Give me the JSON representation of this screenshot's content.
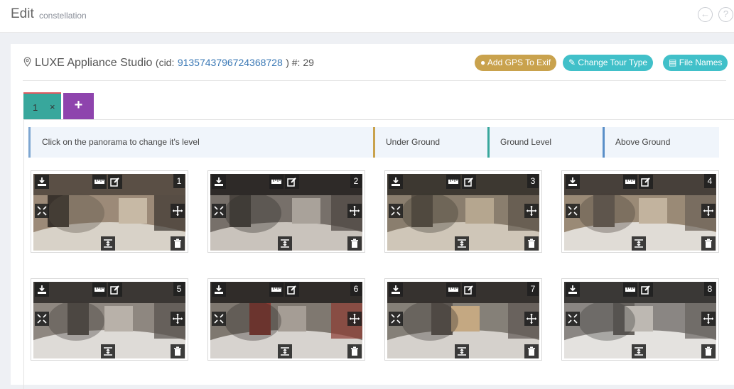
{
  "header": {
    "title": "Edit",
    "subtitle": "constellation",
    "back_icon": "arrow-left-circle-icon",
    "help_icon": "question-circle-icon"
  },
  "location": {
    "name": "LUXE Appliance Studio",
    "cid_prefix": "(cid:",
    "cid": "9135743796724368728",
    "cid_suffix": ") #: 29"
  },
  "actions": {
    "gps_label": "Add GPS To Exif",
    "tour_label": "Change Tour Type",
    "files_label": "File Names"
  },
  "tabs": [
    {
      "label": "1",
      "close": "×"
    }
  ],
  "add_tab_label": "+",
  "levels": {
    "hint": "Click on the panorama to change it's level",
    "under": "Under Ground",
    "ground": "Ground Level",
    "above": "Above Ground"
  },
  "panoramas": [
    {
      "number": "1"
    },
    {
      "number": "2"
    },
    {
      "number": "3"
    },
    {
      "number": "4"
    },
    {
      "number": "5"
    },
    {
      "number": "6"
    },
    {
      "number": "7"
    },
    {
      "number": "8"
    }
  ],
  "colors": {
    "gps": "#c9a24d",
    "teal": "#41c0c9",
    "tab_active": "#38a79c",
    "tab_add": "#8e44ad",
    "cid_link": "#3a78b5"
  }
}
